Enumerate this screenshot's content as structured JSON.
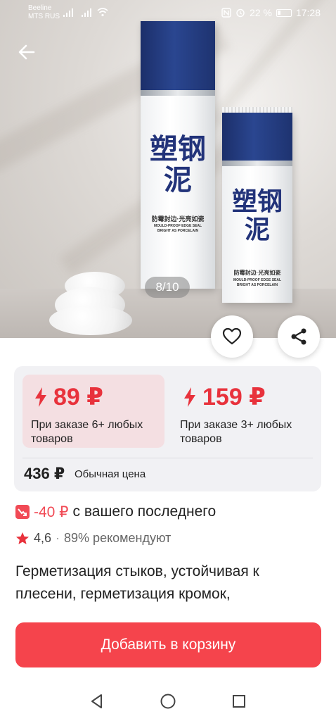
{
  "status_bar": {
    "carrier_1": "Beeline",
    "carrier_2": "MTS RUS",
    "battery": "22 %",
    "time": "17:28"
  },
  "gallery": {
    "counter": "8/10",
    "brand_text": "塑钢泥",
    "tagline_cn": "防霉封边·光亮如瓷",
    "tagline_en_1": "MOULD-PROOF EDGE SEAL",
    "tagline_en_2": "BRIGHT AS PORCELAIN"
  },
  "price_tiers": [
    {
      "price": "89 ₽",
      "note": "При заказе 6+ любых товаров"
    },
    {
      "price": "159 ₽",
      "note": "При заказе 3+ любых товаров"
    }
  ],
  "regular_price": {
    "value": "436 ₽",
    "label": "Обычная цена"
  },
  "discount": {
    "value": "-40 ₽",
    "text": "с вашего последнего"
  },
  "rating": {
    "value": "4,6",
    "separator": "·",
    "recommend": "89% рекомендуют"
  },
  "description": "Герметизация стыков, устойчивая к плесени, герметизация кромок,",
  "cart_button": "Добавить в корзину",
  "colors": {
    "accent": "#f5444c",
    "price_red": "#e8323c",
    "tier_highlight": "#f4dfe2",
    "card_bg": "#f1f1f4"
  },
  "icons": [
    "back-arrow-icon",
    "heart-icon",
    "share-icon",
    "lightning-icon",
    "discount-icon",
    "star-icon",
    "nav-back-icon",
    "nav-home-icon",
    "nav-recents-icon"
  ]
}
